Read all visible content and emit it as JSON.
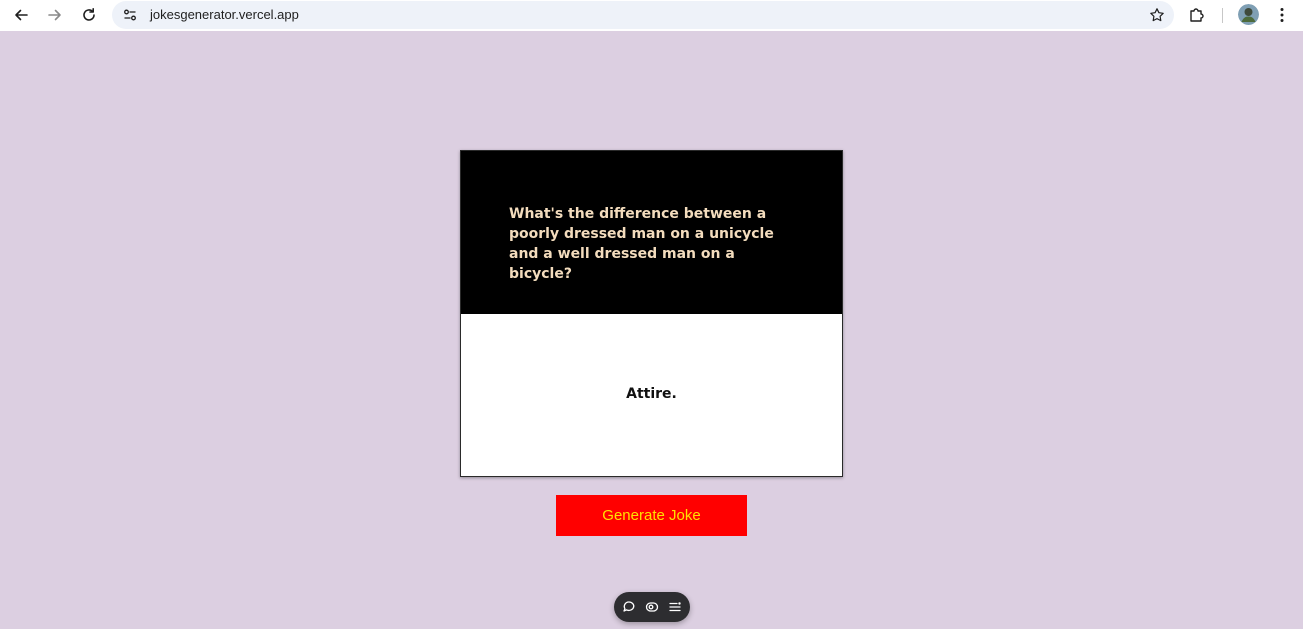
{
  "browser": {
    "url": "jokesgenerator.vercel.app",
    "icons": {
      "back": "arrow-left-icon",
      "forward": "arrow-right-icon",
      "reload": "reload-icon",
      "site_info": "site-controls-icon",
      "bookmark": "star-icon",
      "extensions": "puzzle-icon",
      "profile": "avatar",
      "menu": "kebab-menu-icon"
    }
  },
  "joke": {
    "setup": "What's the difference between a poorly dressed man on a unicycle and a well dressed man on a bicycle?",
    "punchline": "Attire."
  },
  "actions": {
    "generate_label": "Generate Joke"
  },
  "floating_toolbar": {
    "icons": [
      "comment-icon",
      "view-icon",
      "menu-list-icon"
    ]
  },
  "colors": {
    "page_background": "#dccfe1",
    "card_top": "#000000",
    "setup_text": "#f3dcbd",
    "card_bottom": "#ffffff",
    "button_background": "#ff0000",
    "button_text": "#ffe100"
  }
}
